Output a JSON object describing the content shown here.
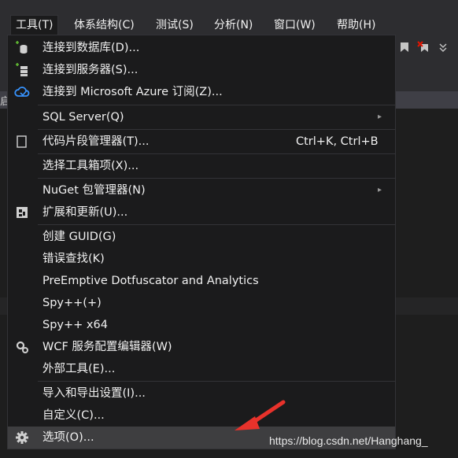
{
  "menubar": {
    "items": [
      {
        "label": "工具(T)"
      },
      {
        "label": "体系结构(C)"
      },
      {
        "label": "测试(S)"
      },
      {
        "label": "分析(N)"
      },
      {
        "label": "窗口(W)"
      },
      {
        "label": "帮助(H)"
      }
    ]
  },
  "tools_menu": {
    "items": [
      {
        "label": "连接到数据库(D)...",
        "icon": "database-connect-icon"
      },
      {
        "label": "连接到服务器(S)...",
        "icon": "server-connect-icon"
      },
      {
        "label": "连接到 Microsoft Azure 订阅(Z)...",
        "icon": "azure-cloud-icon"
      },
      {
        "label": "SQL Server(Q)",
        "submenu": true
      },
      {
        "label": "代码片段管理器(T)...",
        "shortcut": "Ctrl+K, Ctrl+B",
        "icon": "snippet-icon"
      },
      {
        "label": "选择工具箱项(X)..."
      },
      {
        "label": "NuGet 包管理器(N)",
        "submenu": true
      },
      {
        "label": "扩展和更新(U)...",
        "icon": "extensions-icon"
      },
      {
        "label": "创建 GUID(G)"
      },
      {
        "label": "错误查找(K)"
      },
      {
        "label": "PreEmptive Dotfuscator and Analytics"
      },
      {
        "label": "Spy++(+)"
      },
      {
        "label": "Spy++ x64"
      },
      {
        "label": "WCF 服务配置编辑器(W)",
        "icon": "wcf-gear-icon"
      },
      {
        "label": "外部工具(E)..."
      },
      {
        "label": "导入和导出设置(I)..."
      },
      {
        "label": "自定义(C)..."
      },
      {
        "label": "选项(O)...",
        "icon": "gear-icon",
        "highlighted": true
      }
    ],
    "submenu_glyph": "▸"
  },
  "background": {
    "tab_fragment": "启"
  },
  "watermark": "https://blog.csdn.net/Hanghang_",
  "colors": {
    "menu_bg": "#1b1b1c",
    "highlight": "#3e3e40",
    "arrow": "#e8322b",
    "azure": "#3794ff"
  }
}
